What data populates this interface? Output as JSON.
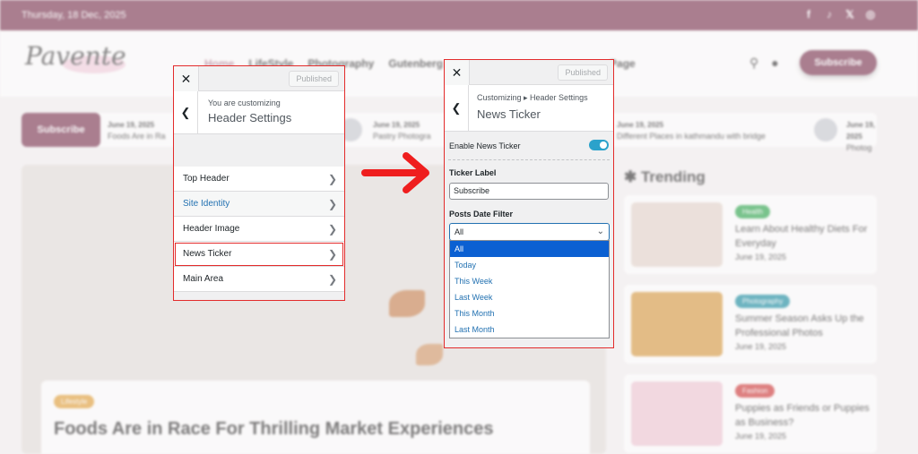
{
  "site": {
    "date": "Thursday, 18 Dec, 2025",
    "logo": "Pavente",
    "nav": [
      "Home",
      "LifeStyle",
      "Photography",
      "Gutenberg",
      "Page"
    ],
    "subscribe": "Subscribe",
    "ticker": {
      "label": "Subscribe",
      "items": [
        {
          "date": "June 19, 2025",
          "title": "Foods Are in Ra"
        },
        {
          "date": "June 19, 2025",
          "title": "Pastry Photogra"
        },
        {
          "date": "June 19, 2025",
          "title": "Different Places in kathmandu with bridge"
        },
        {
          "date": "June 19, 2025",
          "title": "Photog"
        }
      ]
    },
    "hero": {
      "badge": "Lifestyle",
      "title": "Foods Are in Race For Thrilling Market Experiences"
    },
    "trending": {
      "title": "Trending",
      "cards": [
        {
          "tag": "Health",
          "tag_color": "#2fa84f",
          "title": "Learn About Healthy Diets For Everyday",
          "date": "June 19, 2025",
          "img": "#e6d7ce"
        },
        {
          "tag": "Photography",
          "tag_color": "#1c8fa3",
          "title": "Summer Season Asks Up the Professional Photos",
          "date": "June 19, 2025",
          "img": "#d99d45"
        },
        {
          "tag": "Fashion",
          "tag_color": "#d13b3b",
          "title": "Puppies as Friends or Puppies as Business?",
          "date": "June 19, 2025",
          "img": "#f1c9d6"
        }
      ]
    }
  },
  "panel1": {
    "close": "✕",
    "published": "Published",
    "note": "You are customizing",
    "heading": "Header Settings",
    "items": [
      "Top Header",
      "Site Identity",
      "Header Image",
      "News Ticker",
      "Main Area"
    ]
  },
  "panel2": {
    "close": "✕",
    "published": "Published",
    "breadcrumb": "Customizing ▸ Header Settings",
    "title": "News Ticker",
    "enable_label": "Enable News Ticker",
    "ticker_label_title": "Ticker Label",
    "ticker_label_value": "Subscribe",
    "filter_title": "Posts Date Filter",
    "filter_selected": "All",
    "filter_options": [
      "All",
      "Today",
      "This Week",
      "Last Week",
      "This Month",
      "Last Month"
    ]
  },
  "colors": {
    "brand": "#7d3853",
    "highlight": "#e32b2b",
    "toggle": "#2ba2cb",
    "select_active": "#0b60d2"
  }
}
